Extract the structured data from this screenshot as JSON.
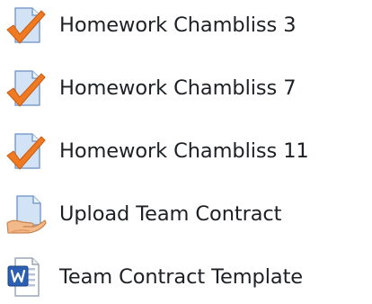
{
  "activities": [
    {
      "label": "Homework Chambliss 3",
      "icon": "assignment-icon"
    },
    {
      "label": "Homework Chambliss 7",
      "icon": "assignment-icon"
    },
    {
      "label": "Homework Chambliss 11",
      "icon": "assignment-icon"
    },
    {
      "label": "Upload Team Contract",
      "icon": "upload-icon"
    },
    {
      "label": "Team Contract Template",
      "icon": "word-document-icon"
    }
  ]
}
